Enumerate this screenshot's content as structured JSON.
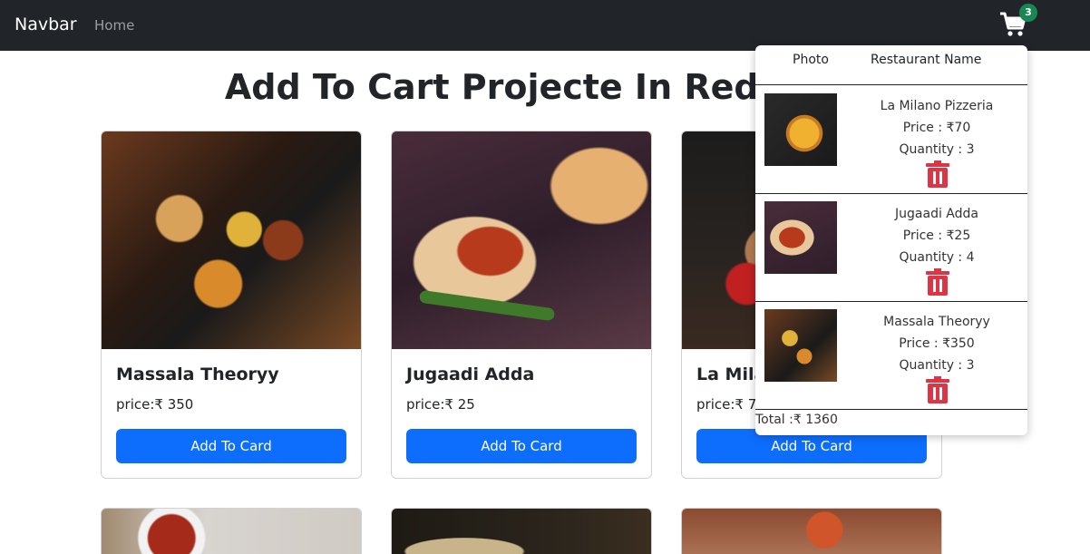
{
  "navbar": {
    "brand": "Navbar",
    "home": "Home",
    "cart_count": "3",
    "cart_icon": "shopping-cart-icon"
  },
  "page": {
    "title": "Add To Cart Projecte In Redux"
  },
  "cards": [
    {
      "name": "Massala Theoryy",
      "price": "price:₹ 350",
      "button": "Add To Card"
    },
    {
      "name": "Jugaadi Adda",
      "price": "price:₹ 25",
      "button": "Add To Card"
    },
    {
      "name": "La Milano Pizzeria",
      "price": "price:₹ 70",
      "button": "Add To Card"
    }
  ],
  "cart": {
    "headers": {
      "photo": "Photo",
      "restaurant": "Restaurant Name"
    },
    "items": [
      {
        "name": "La Milano Pizzeria",
        "price": "Price : ₹70",
        "quantity": "Quantity : 3"
      },
      {
        "name": "Jugaadi Adda",
        "price": "Price : ₹25",
        "quantity": "Quantity : 4"
      },
      {
        "name": "Massala Theoryy",
        "price": "Price : ₹350",
        "quantity": "Quantity : 3"
      }
    ],
    "total": "Total :₹ 1360",
    "colors": {
      "trash": "#dc3545",
      "badge": "#198754",
      "button": "#0d6efd",
      "navbar": "#212529"
    }
  }
}
